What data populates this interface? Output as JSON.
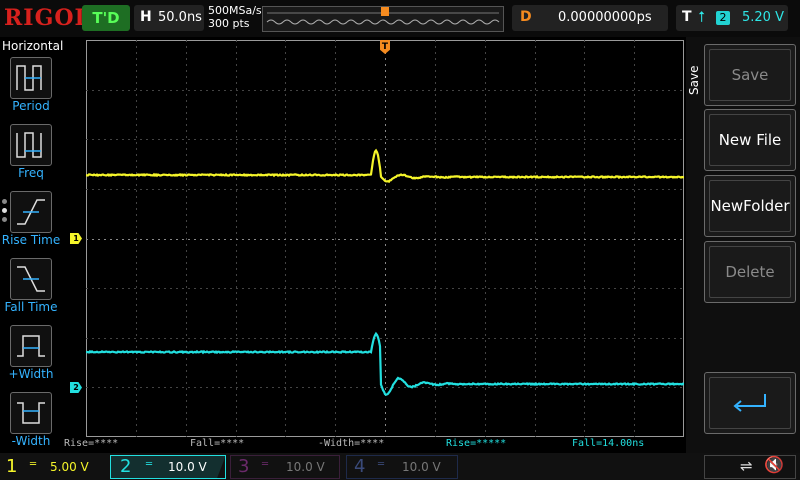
{
  "header": {
    "logo": "RIGOL",
    "run_status": "T'D",
    "horizontal": {
      "label": "H",
      "value": "50.0ns"
    },
    "sample_rate": "500MSa/s",
    "points": "300 pts",
    "delay": {
      "label": "D",
      "value": "0.00000000ps"
    },
    "trigger": {
      "label": "T",
      "source": "2",
      "level": "5.20 V"
    }
  },
  "left_menu": {
    "title": "Horizontal",
    "items": [
      {
        "label": "Period"
      },
      {
        "label": "Freq"
      },
      {
        "label": "Rise Time"
      },
      {
        "label": "Fall Time"
      },
      {
        "label": "+Width"
      },
      {
        "label": "-Width"
      }
    ]
  },
  "markers": {
    "ch1": "1",
    "ch2": "2",
    "trigger_top": "T",
    "trigger_level": "T"
  },
  "measurements": {
    "rise1": "Rise=****",
    "fall1": "Fall=****",
    "nwidth": "-Width=****",
    "rise2": "Rise=*****",
    "fall2": "Fall=14.00ns"
  },
  "right_menu": {
    "title": "Save",
    "buttons": [
      {
        "label": "Save",
        "enabled": false
      },
      {
        "label": "New File",
        "enabled": true
      },
      {
        "label": "NewFolder",
        "enabled": true
      },
      {
        "label": "Delete",
        "enabled": false
      }
    ]
  },
  "channels": [
    {
      "num": "1",
      "scale": "5.00 V",
      "color": "#f5f52a"
    },
    {
      "num": "2",
      "scale": "10.0 V",
      "color": "#22e0e0"
    },
    {
      "num": "3",
      "scale": "10.0 V",
      "color": "#c33ec3"
    },
    {
      "num": "4",
      "scale": "10.0 V",
      "color": "#3a6cf0"
    }
  ],
  "colors": {
    "ch1": "#f5f52a",
    "ch2": "#22e0e0",
    "trigger": "#f68b1f",
    "menu_label": "#34b3ff"
  }
}
